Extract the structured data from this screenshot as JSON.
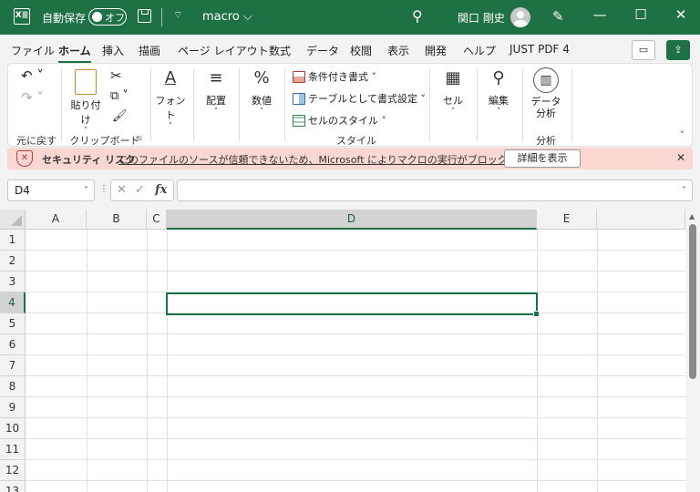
{
  "titlebar": {
    "logo": "X≣",
    "autosave_label": "自動保存",
    "autosave_state": "オフ",
    "qat_more": "⌔",
    "filename": "macro ⌵",
    "search_glyph": "⚲",
    "username": "関口 剛史",
    "pen_glyph": "✎",
    "minimize": "—",
    "maximize": "☐",
    "close": "✕"
  },
  "tabs": [
    "ファイル",
    "ホーム",
    "挿入",
    "描画",
    "ページ レイアウト",
    "数式",
    "データ",
    "校閲",
    "表示",
    "開発",
    "ヘルプ",
    "JUST PDF 4"
  ],
  "active_tab": "ホーム",
  "tab_buttons": {
    "comment": "▭",
    "share": "⇪"
  },
  "ribbon": {
    "undo_group_label": "元に戻す",
    "undo_glyph": "↶ ˅",
    "redo_glyph": "↷ ˅",
    "paste_label": "貼り付け",
    "paste_caret": "˅",
    "cut_glyph": "✂",
    "copy_glyph": "⧉ ˅",
    "brush_glyph": "🖌",
    "clipboard_label": "クリップボード",
    "clipboard_launcher": "⧅",
    "font_label": "フォント",
    "font_glyph": "A",
    "align_label": "配置",
    "align_glyph": "≡",
    "number_label": "数値",
    "number_glyph": "%",
    "cond_format_label": "条件付き書式 ˅",
    "table_format_label": "テーブルとして書式設定 ˅",
    "cell_style_label": "セルのスタイル ˅",
    "styles_group_label": "スタイル",
    "cells_label": "セル",
    "cells_glyph": "▦",
    "edit_label": "編集",
    "edit_glyph": "⚲",
    "analysis_button": "データ\n分析",
    "analysis_line1": "データ",
    "analysis_line2": "分析",
    "analysis_glyph": "▥",
    "analysis_group_label": "分析",
    "caret": "˅",
    "collapse": "˅"
  },
  "security_bar": {
    "title": "セキュリティ リスク",
    "message": "このファイルのソースが信頼できないため、Microsoft によりマクロの実行がブロックされました。",
    "button": "詳細を表示",
    "close": "✕"
  },
  "formula_bar": {
    "name_box": "D4",
    "caret": "˅",
    "dots": "⋮",
    "cancel": "✕",
    "enter": "✓",
    "fx": "fx",
    "value": ""
  },
  "sheet": {
    "columns": [
      "A",
      "B",
      "C",
      "D",
      "E"
    ],
    "rows": [
      "1",
      "2",
      "3",
      "4",
      "5",
      "6",
      "7",
      "8",
      "9",
      "10",
      "11",
      "12",
      "13"
    ],
    "selected_column": "D",
    "selected_row": "4",
    "active_cell": "D4"
  },
  "colors": {
    "accent": "#1e7145",
    "security_bg": "#fbd7d3"
  }
}
